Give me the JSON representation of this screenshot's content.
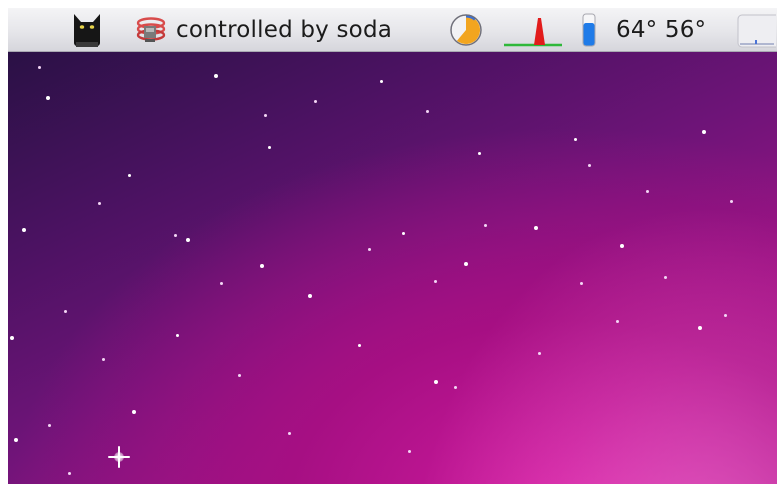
{
  "menubar": {
    "extras": [
      {
        "name": "cat-icon"
      },
      {
        "name": "network-icon"
      },
      {
        "label": "controlled by soda"
      },
      {
        "name": "pie-chart-icon"
      },
      {
        "name": "activity-graph-icon"
      },
      {
        "name": "thermometer-icon"
      },
      {
        "label": "64° 56°"
      },
      {
        "name": "blank-menu-icon"
      }
    ]
  },
  "colors": {
    "menubar_text": "#1b1b1b",
    "pie_fill": "#f2a51f",
    "pie_remaining": "#3a6fd4",
    "graph_spike": "#e21b1b",
    "graph_baseline": "#2fb83a",
    "thermometer_fill": "#1f7be8",
    "wallpaper_base": "#6e1478"
  }
}
